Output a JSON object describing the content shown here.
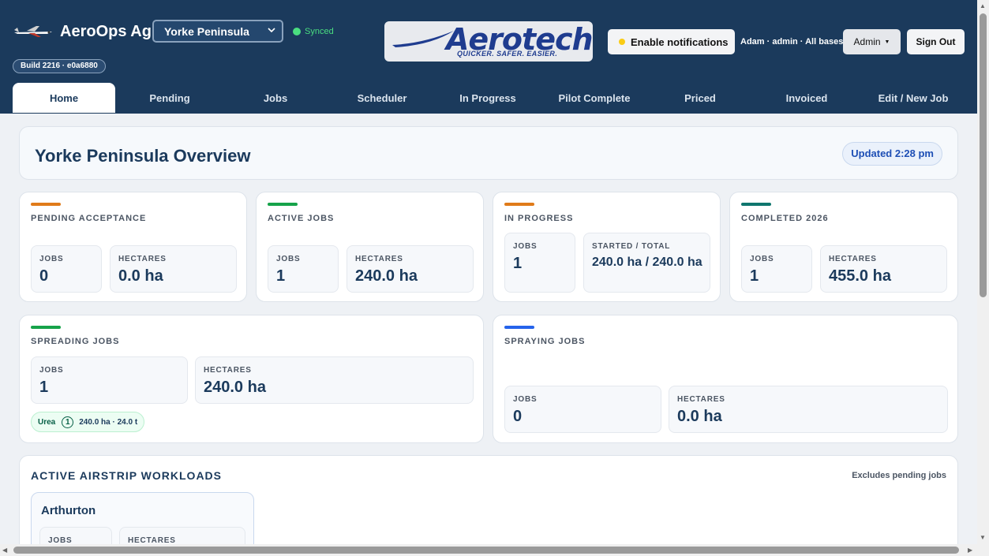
{
  "header": {
    "app_name": "AeroOps Ag",
    "region": "Yorke Peninsula",
    "sync_status": "Synced",
    "build": "Build 2216 · e0a6880",
    "logo_text": "Aerotech",
    "logo_tagline": "QUICKER. SAFER. EASIER.",
    "notifications_label": "Enable notifications",
    "user_info": "Adam · admin · All bases",
    "role": "Admin",
    "sign_out": "Sign Out",
    "icons": {
      "brand": "plane-icon",
      "region": "chevron-down-icon",
      "sync": "status-dot-icon"
    }
  },
  "tabs": [
    {
      "label": "Home",
      "active": true
    },
    {
      "label": "Pending"
    },
    {
      "label": "Jobs"
    },
    {
      "label": "Scheduler"
    },
    {
      "label": "In Progress"
    },
    {
      "label": "Pilot Complete"
    },
    {
      "label": "Priced"
    },
    {
      "label": "Invoiced"
    },
    {
      "label": "Edit / New Job"
    }
  ],
  "overview": {
    "title": "Yorke Peninsula Overview",
    "updated": "Updated 2:28 pm"
  },
  "cards": {
    "pending": {
      "label": "PENDING ACCEPTANCE",
      "accent": "#e07b1a",
      "jobs_label": "JOBS",
      "jobs": "0",
      "ha_label": "HECTARES",
      "ha": "0.0 ha"
    },
    "active": {
      "label": "ACTIVE JOBS",
      "accent": "#16a34a",
      "jobs_label": "JOBS",
      "jobs": "1",
      "ha_label": "HECTARES",
      "ha": "240.0 ha"
    },
    "inprogress": {
      "label": "IN PROGRESS",
      "accent": "#e07b1a",
      "jobs_label": "JOBS",
      "jobs": "1",
      "ha_label": "STARTED / TOTAL",
      "ha": "240.0 ha / 240.0 ha"
    },
    "completed": {
      "label": "COMPLETED 2026",
      "accent": "#0f766e",
      "jobs_label": "JOBS",
      "jobs": "1",
      "ha_label": "HECTARES",
      "ha": "455.0 ha"
    },
    "spreading": {
      "label": "SPREADING JOBS",
      "accent": "#16a34a",
      "jobs_label": "JOBS",
      "jobs": "1",
      "ha_label": "HECTARES",
      "ha": "240.0 ha",
      "chip": {
        "product": "Urea",
        "count": "1",
        "summary": "240.0 ha · 24.0 t"
      }
    },
    "spraying": {
      "label": "SPRAYING JOBS",
      "accent": "#2563eb",
      "jobs_label": "JOBS",
      "jobs": "0",
      "ha_label": "HECTARES",
      "ha": "0.0 ha"
    }
  },
  "workloads": {
    "title": "ACTIVE AIRSTRIP WORKLOADS",
    "note": "Excludes pending jobs",
    "strips": [
      {
        "name": "Arthurton",
        "jobs_label": "JOBS",
        "ha_label": "HECTARES"
      }
    ]
  }
}
